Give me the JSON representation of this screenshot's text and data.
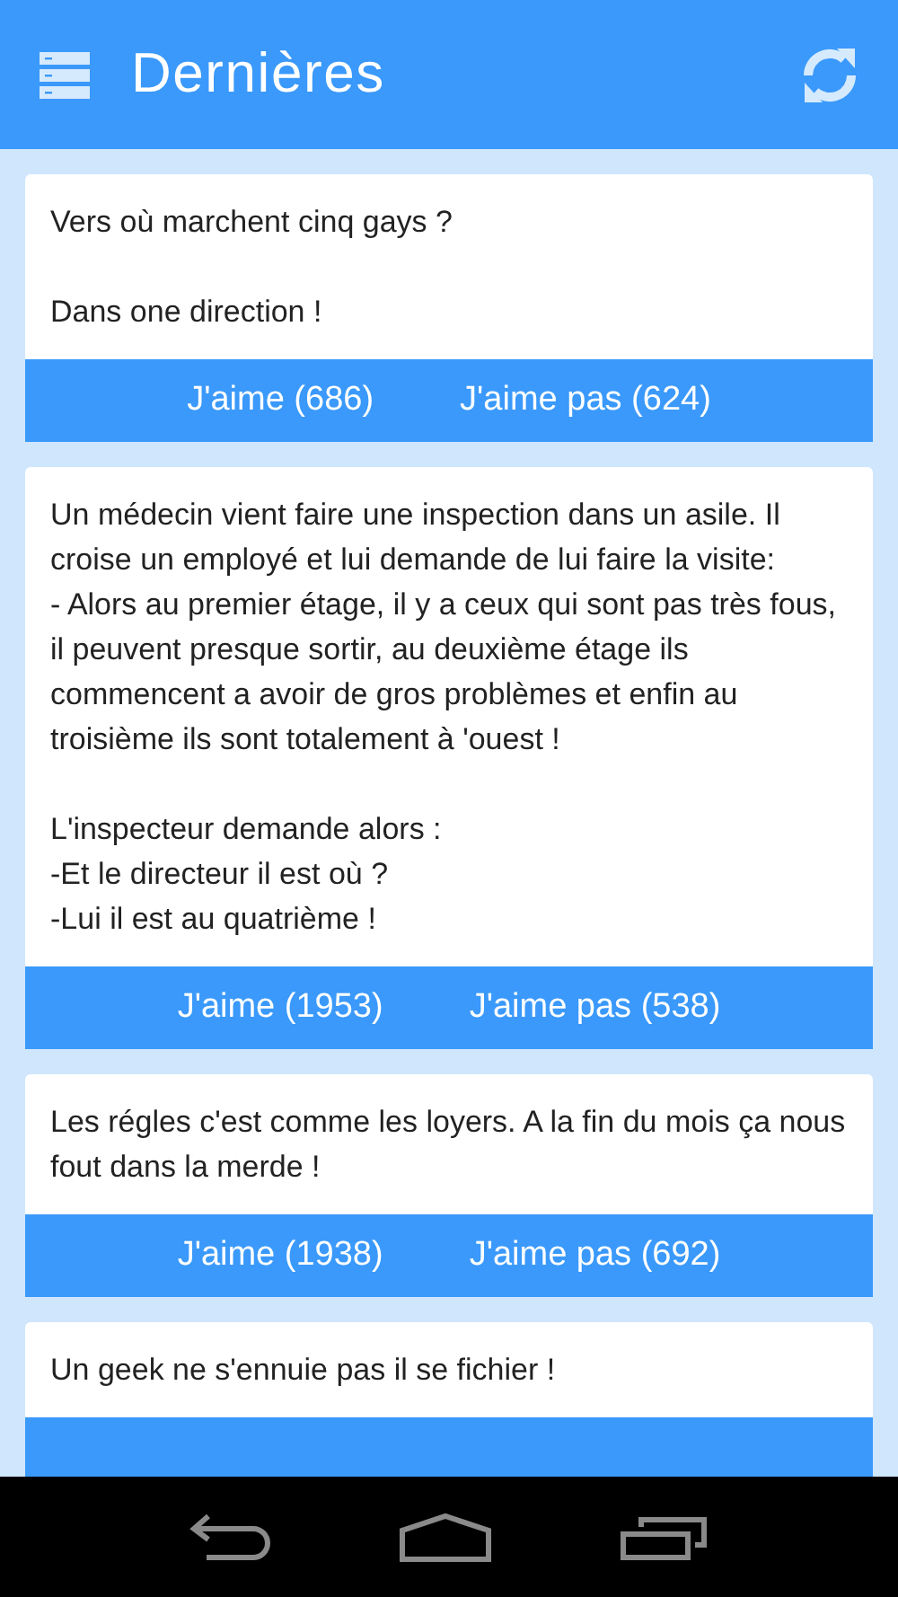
{
  "app_bar": {
    "title": "Dernières"
  },
  "jokes": [
    {
      "text": "Vers où marchent cinq gays ?\n\nDans one direction !",
      "buttons": [
        "J'aime (686)",
        "J'aime pas (624)"
      ]
    },
    {
      "text": "Un médecin vient faire une inspection dans un asile. Il croise un employé et lui demande de lui faire la visite:\n- Alors au premier étage, il y a ceux qui sont pas très fous, il peuvent presque sortir, au deuxième étage ils commencent a avoir de gros problèmes et enfin au troisième ils sont totalement à 'ouest !\n\nL'inspecteur demande alors :\n-Et le directeur il est où ?\n-Lui il est au quatrième !",
      "buttons": [
        "J'aime (1953)",
        "J'aime pas (538)"
      ]
    },
    {
      "text": "Les régles c'est comme les loyers. A la fin du mois ça nous fout dans la merde !",
      "buttons": [
        "J'aime (1938)",
        "J'aime pas (692)"
      ]
    },
    {
      "text": "Un geek ne s'ennuie pas il se fichier !"
    }
  ]
}
